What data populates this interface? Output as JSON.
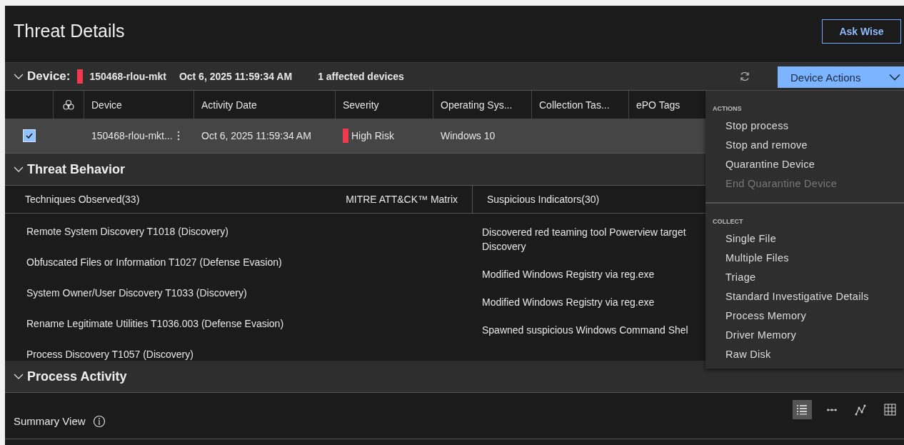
{
  "page_title": "Threat Details",
  "ask_button": "Ask Wise",
  "device_bar": {
    "label": "Device:",
    "color": "#f0394f",
    "device": "150468-rlou-mkt",
    "date": "Oct 6, 2025 11:59:34 AM",
    "affected": "1 affected devices",
    "actions_button": "Device Actions",
    "expanded": true
  },
  "table": {
    "columns": [
      "",
      "",
      "Device",
      "Activity Date",
      "Severity",
      "Operating Sys...",
      "Collection Tas...",
      "ePO Tags"
    ],
    "rows": [
      {
        "checked": true,
        "device": "150468-rlou-mkt...",
        "date": "Oct 6, 2025 11:59:34 AM",
        "severity": "High Risk",
        "color": "#f0394f",
        "os": "Windows 10"
      }
    ]
  },
  "threat_behavior": {
    "title": "Threat Behavior",
    "expanded": true,
    "tabs": [
      {
        "label": "Techniques Observed(33)"
      },
      {
        "label": "MITRE ATT&CK™ Matrix"
      },
      {
        "label": "Suspicious Indicators(30)"
      }
    ],
    "techniques": [
      "Remote System Discovery T1018 (Discovery)",
      "Obfuscated Files or Information T1027 (Defense Evasion)",
      "System Owner/User Discovery T1033 (Discovery)",
      "Rename Legitimate Utilities T1036.003 (Defense Evasion)",
      "Process Discovery T1057 (Discovery)"
    ],
    "indicators": [
      "Discovered red teaming tool Powerview target\nDiscovery",
      "Modified Windows Registry via reg.exe",
      "Modified Windows Registry via reg.exe",
      "Spawned suspicious Windows Command Shel"
    ]
  },
  "process_activity": {
    "title": "Process Activity",
    "expanded": true,
    "summary": "Summary View",
    "views": [
      {
        "kind": "list",
        "selected": true
      },
      {
        "kind": "dots",
        "selected": false
      },
      {
        "kind": "graph",
        "selected": false
      },
      {
        "kind": "grid",
        "selected": false
      }
    ]
  },
  "menu": [
    {
      "heading": "ACTIONS",
      "items": [
        {
          "label": "Stop process",
          "disabled": false
        },
        {
          "label": "Stop and remove",
          "disabled": false
        },
        {
          "label": "Quarantine Device",
          "disabled": false
        },
        {
          "label": "End Quarantine Device",
          "disabled": true
        }
      ]
    },
    {
      "heading": "COLLECT",
      "items": [
        {
          "label": "Single File",
          "disabled": false
        },
        {
          "label": "Multiple Files",
          "disabled": false
        },
        {
          "label": "Triage",
          "disabled": false
        },
        {
          "label": "Standard Investigative Details",
          "disabled": false
        },
        {
          "label": "Process Memory",
          "disabled": false
        },
        {
          "label": "Driver Memory",
          "disabled": false
        },
        {
          "label": "Raw Disk",
          "disabled": false
        }
      ]
    }
  ]
}
